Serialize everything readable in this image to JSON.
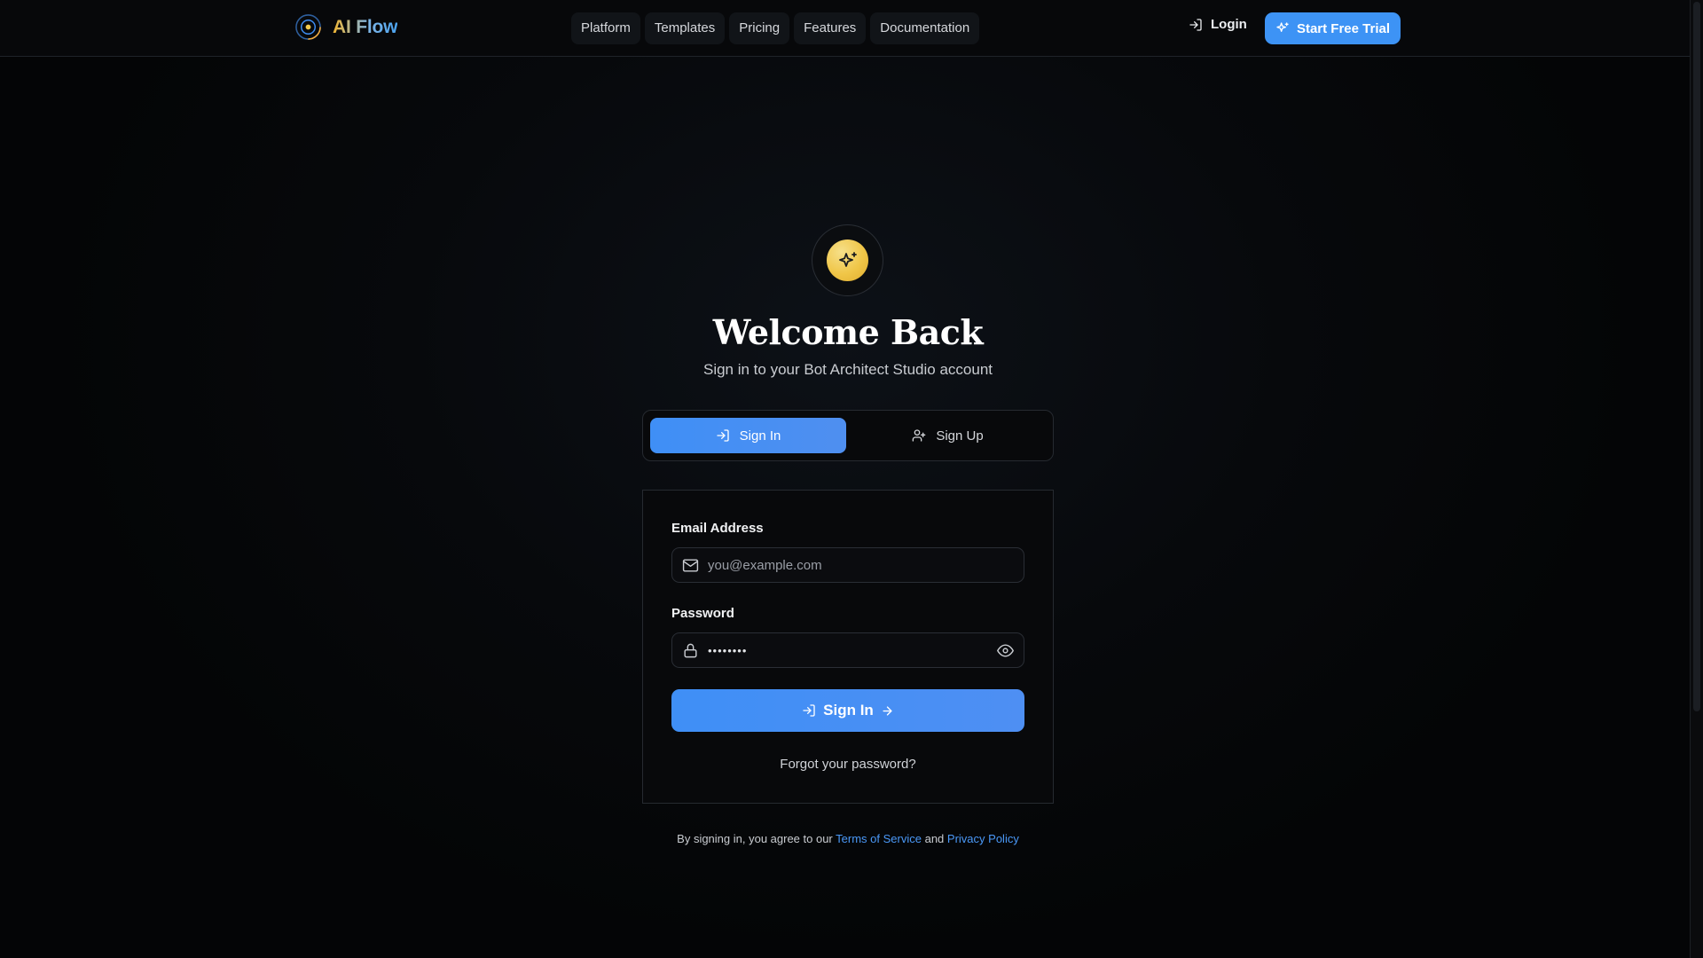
{
  "header": {
    "brand": "AI Flow",
    "nav": [
      "Platform",
      "Templates",
      "Pricing",
      "Features",
      "Documentation"
    ],
    "login_label": "Login",
    "trial_label": "Start Free Trial"
  },
  "hero": {
    "title": "Welcome Back",
    "subtitle": "Sign in to your Bot Architect Studio account"
  },
  "tabs": {
    "signin_label": "Sign In",
    "signup_label": "Sign Up",
    "active": "Sign In"
  },
  "form": {
    "email_label": "Email Address",
    "email_placeholder": "you@example.com",
    "email_value": "",
    "password_label": "Password",
    "password_value": "••••••••",
    "submit_label": "Sign In",
    "forgot_label": "Forgot your password?"
  },
  "legal": {
    "prefix": "By signing in, you agree to our",
    "terms": "Terms of Service",
    "and": "and",
    "privacy": "Privacy Policy"
  },
  "colors": {
    "accent": "#3d93f5",
    "link": "#4a98f7",
    "hero_icon": "#f0c648",
    "background": "#050608"
  },
  "icons": {
    "brand": "orbit-logo-icon",
    "login": "log-in-icon",
    "trial": "sparkles-icon",
    "hero": "sparkles-icon",
    "signup": "user-plus-icon",
    "email": "mail-icon",
    "password": "lock-icon",
    "visibility": "eye-icon",
    "submit_arrow": "arrow-right-icon"
  }
}
